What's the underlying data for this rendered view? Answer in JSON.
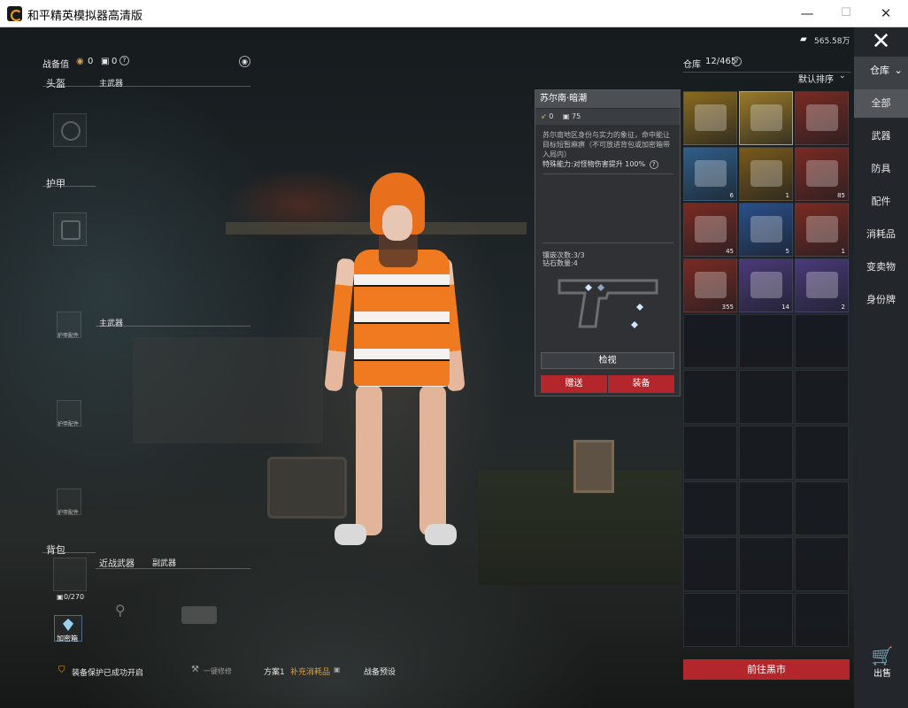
{
  "window": {
    "title": "和平精英模拟器高清版",
    "min": "—",
    "max": "☐",
    "close": "✕"
  },
  "loadout": {
    "power_label": "战备值",
    "power_value1": "0",
    "power_value2": "0",
    "helmet_label": "头盔",
    "primary_label": "主武器",
    "primary_label2": "主武器",
    "armor_label": "护甲",
    "armor_part": "护甲配件",
    "backpack_label": "背包",
    "backpack_capacity": "0/270",
    "melee_label": "近战武器",
    "secondary_label": "副武器",
    "safebox_label": "加密箱",
    "protect_msg": "装备保护已成功开启",
    "one_click_label": "一键修修",
    "plan_label": "方案1",
    "plan_value": "补充消耗品",
    "plan_tag": "▣",
    "preset_label": "战备预设"
  },
  "detail": {
    "name": "苏尔南·暗潮",
    "stat1": "0",
    "stat2": "75",
    "desc": "苏尔南地区身份与实力的象征，命中能让目标短暂麻痹（不可放进背包或加密箱带入局内）",
    "ability": "特殊能力:对怪物伤害提升",
    "ability_value": "100%",
    "inlay": "镶嵌次数:3/3",
    "diamonds": "钻石数量:4",
    "inspect": "检视",
    "gift": "赠送",
    "equip": "装备"
  },
  "inventory": {
    "currency": "565.58万",
    "title": "仓库",
    "count": "12/465",
    "sort": "默认排序",
    "items": [
      {
        "name": "purple-saber",
        "qty": "",
        "color": "#8a6a1e"
      },
      {
        "name": "gold-pistol",
        "qty": "",
        "color": "#9a7a28"
      },
      {
        "name": "armor-vest",
        "qty": "",
        "color": "#7a2a22"
      },
      {
        "name": "silver-case",
        "qty": "6",
        "color": "#2f5f8a"
      },
      {
        "name": "gold-card",
        "qty": "1",
        "color": "#7a5a1a"
      },
      {
        "name": "books",
        "qty": "85",
        "color": "#7a2a22"
      },
      {
        "name": "gold-box",
        "qty": "45",
        "color": "#7a2a22"
      },
      {
        "name": "blue-ticket",
        "qty": "5",
        "color": "#2a4f8a"
      },
      {
        "name": "grey-card",
        "qty": "1",
        "color": "#7a2a22"
      },
      {
        "name": "bird-dome",
        "qty": "355",
        "color": "#7a2a22"
      },
      {
        "name": "green-card",
        "qty": "14",
        "color": "#4a3a7a"
      },
      {
        "name": "gem-card",
        "qty": "2",
        "color": "#4a3a7a"
      }
    ],
    "blackmarket": "前往黑市"
  },
  "categories": {
    "repo": "仓库",
    "list": [
      "全部",
      "武器",
      "防具",
      "配件",
      "消耗品",
      "变卖物",
      "身份牌"
    ],
    "sell": "出售"
  },
  "colors": {
    "accent": "#b3262b",
    "orange": "#f07a20"
  }
}
